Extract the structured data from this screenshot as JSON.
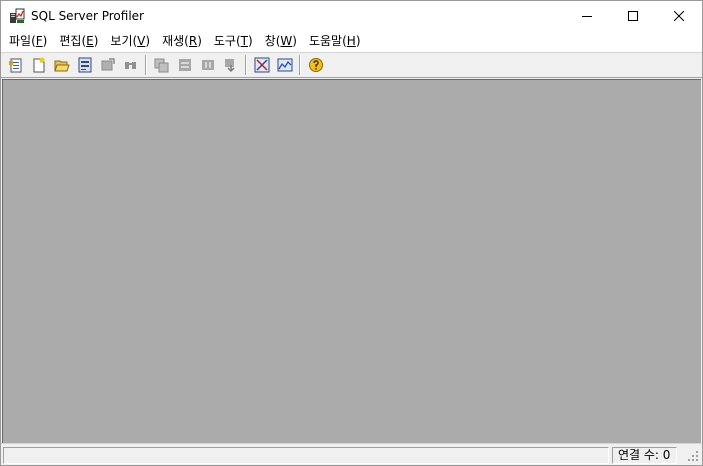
{
  "window": {
    "title": "SQL Server Profiler"
  },
  "menu": [
    {
      "label": "파일(",
      "key": "F",
      "end": ")"
    },
    {
      "label": "편집(",
      "key": "E",
      "end": ")"
    },
    {
      "label": "보기(",
      "key": "V",
      "end": ")"
    },
    {
      "label": "재생(",
      "key": "R",
      "end": ")"
    },
    {
      "label": "도구(",
      "key": "T",
      "end": ")"
    },
    {
      "label": "창(",
      "key": "W",
      "end": ")"
    },
    {
      "label": "도움말(",
      "key": "H",
      "end": ")"
    }
  ],
  "status": {
    "connections": "연결 수: 0"
  },
  "colors": {
    "client_bg": "#ababab",
    "chrome_bg": "#f0f0f0"
  }
}
